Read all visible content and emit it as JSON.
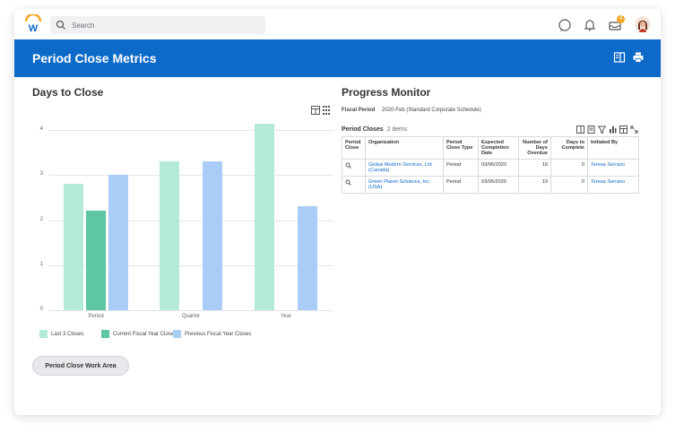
{
  "search": {
    "placeholder": "Search"
  },
  "topbar": {
    "notification_count": "4"
  },
  "banner": {
    "title": "Period Close Metrics"
  },
  "left": {
    "title": "Days to Close",
    "button": "Period Close Work Area"
  },
  "chart_data": {
    "type": "bar",
    "title": "Days to Close",
    "categories": [
      "Period",
      "Quarter",
      "Year"
    ],
    "series": [
      {
        "name": "Last 3 Closes",
        "color": "#b4ead9",
        "values": [
          2.8,
          3.3,
          4.15
        ]
      },
      {
        "name": "Current Fiscal Year Closes",
        "color": "#5ec7a1",
        "values": [
          2.2,
          null,
          null
        ]
      },
      {
        "name": "Previous Fiscal Year Closes",
        "color": "#a9cdf7",
        "values": [
          3.0,
          3.3,
          2.3
        ]
      }
    ],
    "yticks": [
      "0",
      "1",
      "2",
      "3",
      "4"
    ],
    "ylim": [
      0,
      4.3
    ],
    "grid": true,
    "legend": "bottom"
  },
  "right": {
    "title": "Progress Monitor",
    "fiscal_label": "Fiscal Period",
    "fiscal_value": "2020-Feb (Standard Corporate Schedule)",
    "pc_label": "Period Closes",
    "pc_count": "2 items",
    "headers": [
      "Period Close",
      "Organization",
      "Period Close Type",
      "Expected Completion Date",
      "Number of Days Overdue",
      "Days to Complete",
      "Initiated By"
    ],
    "rows": [
      {
        "org": "Global Modern Services, Ltd (Canada)",
        "type": "Period",
        "date": "03/06/2020",
        "overdue": "19",
        "complete": "0",
        "by": "Teresa Serrano"
      },
      {
        "org": "Green Planet Solutions, Inc. (USA)",
        "type": "Period",
        "date": "03/06/2020",
        "overdue": "19",
        "complete": "0",
        "by": "Teresa Serrano"
      }
    ]
  }
}
